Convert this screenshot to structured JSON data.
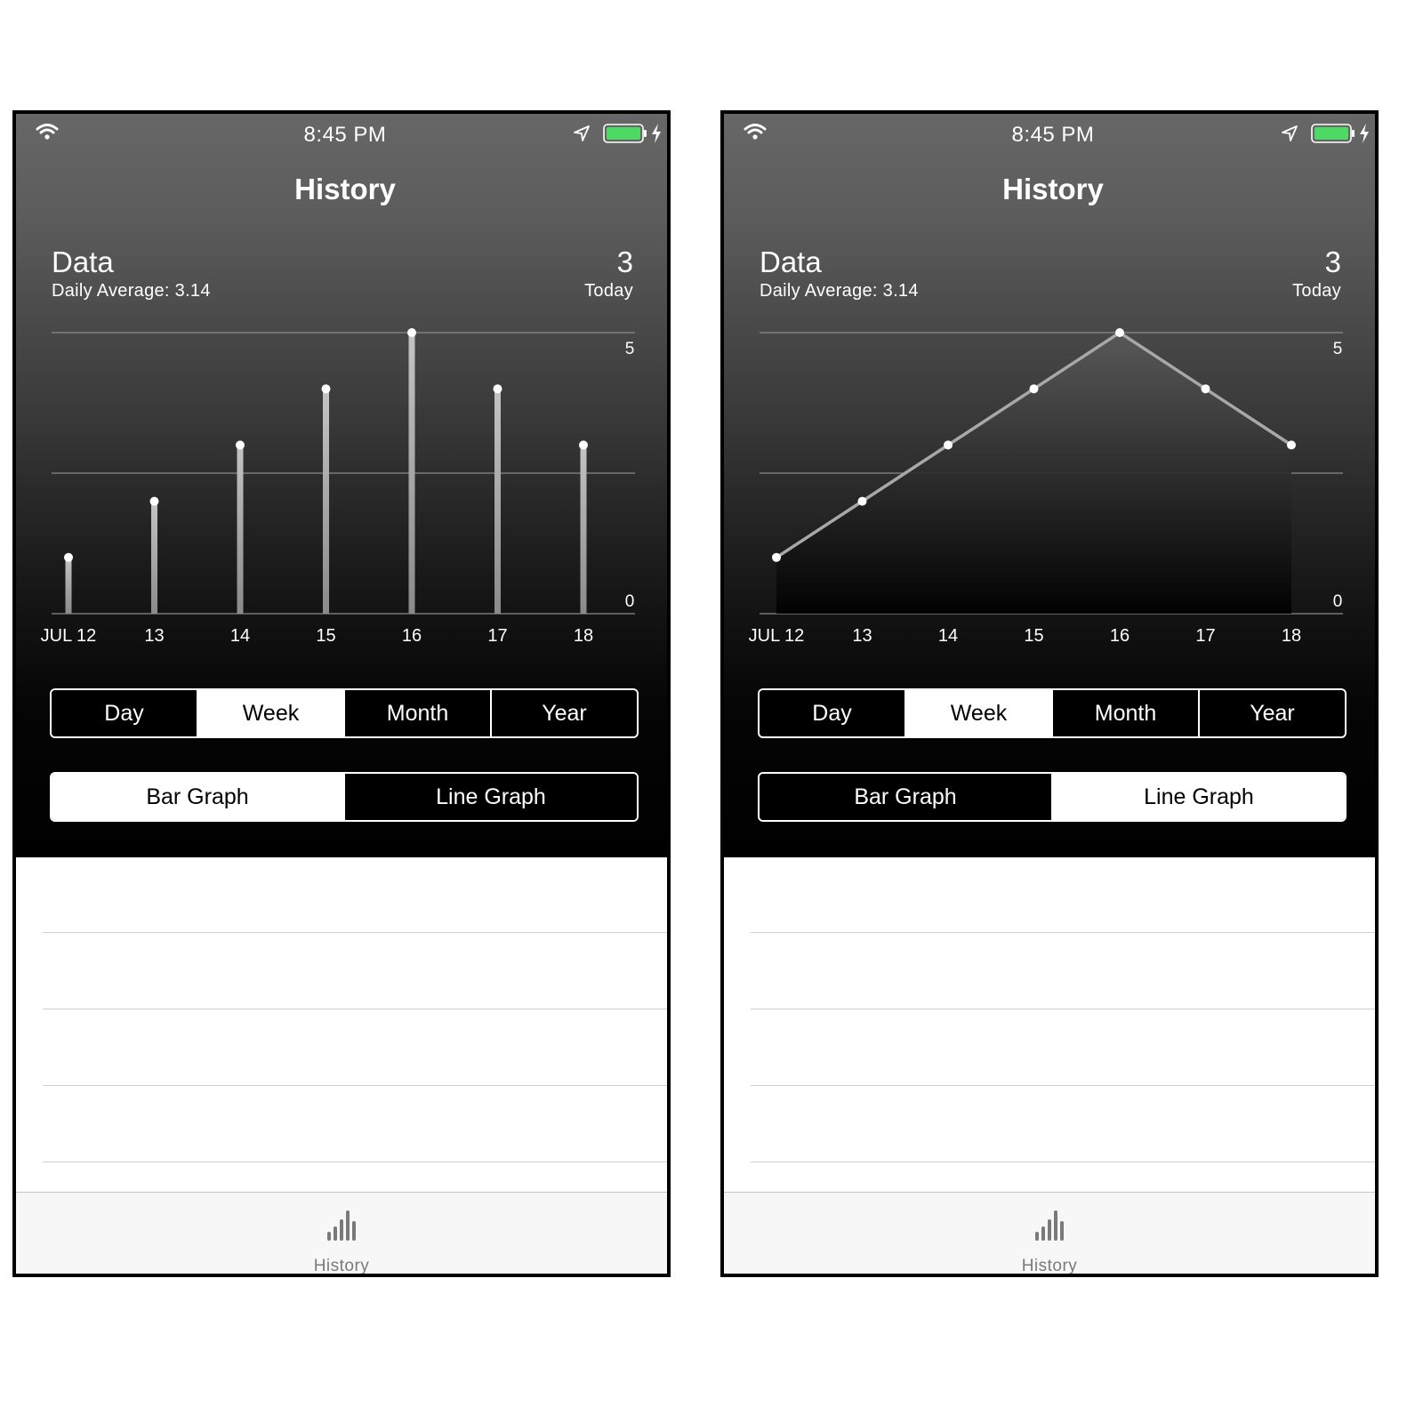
{
  "screens": [
    {
      "status": {
        "time": "8:45 PM"
      },
      "nav_title": "History",
      "header": {
        "title": "Data",
        "subtitle": "Daily Average: 3.14",
        "today_value": "3",
        "today_label": "Today"
      },
      "range_segments": [
        "Day",
        "Week",
        "Month",
        "Year"
      ],
      "range_selected": "Week",
      "graph_segments": [
        "Bar Graph",
        "Line Graph"
      ],
      "graph_selected": "Bar Graph",
      "tab": {
        "label": "History"
      }
    },
    {
      "status": {
        "time": "8:45 PM"
      },
      "nav_title": "History",
      "header": {
        "title": "Data",
        "subtitle": "Daily Average: 3.14",
        "today_value": "3",
        "today_label": "Today"
      },
      "range_segments": [
        "Day",
        "Week",
        "Month",
        "Year"
      ],
      "range_selected": "Week",
      "graph_segments": [
        "Bar Graph",
        "Line Graph"
      ],
      "graph_selected": "Line Graph",
      "tab": {
        "label": "History"
      }
    }
  ],
  "chart_data": [
    {
      "type": "bar",
      "categories": [
        "JUL 12",
        "13",
        "14",
        "15",
        "16",
        "17",
        "18"
      ],
      "values": [
        1,
        2,
        3,
        4,
        5,
        4,
        3
      ],
      "ylim": [
        0,
        5
      ],
      "ytick_labels": [
        "0",
        "5"
      ],
      "grid": true
    },
    {
      "type": "area",
      "categories": [
        "JUL 12",
        "13",
        "14",
        "15",
        "16",
        "17",
        "18"
      ],
      "values": [
        1,
        2,
        3,
        4,
        5,
        4,
        3
      ],
      "ylim": [
        0,
        5
      ],
      "ytick_labels": [
        "0",
        "5"
      ],
      "grid": true
    }
  ],
  "colors": {
    "battery_fill": "#4cd964",
    "mark": "#ffffff",
    "bar_stem": "#9a9a9a",
    "line_stroke": "#a8a8a8",
    "grid": "#8a8a8a"
  },
  "icons": {
    "wifi": "wifi-icon",
    "location": "location-arrow-icon",
    "battery": "battery-icon",
    "charging": "lightning-bolt-icon",
    "tab": "bar-chart-icon"
  }
}
